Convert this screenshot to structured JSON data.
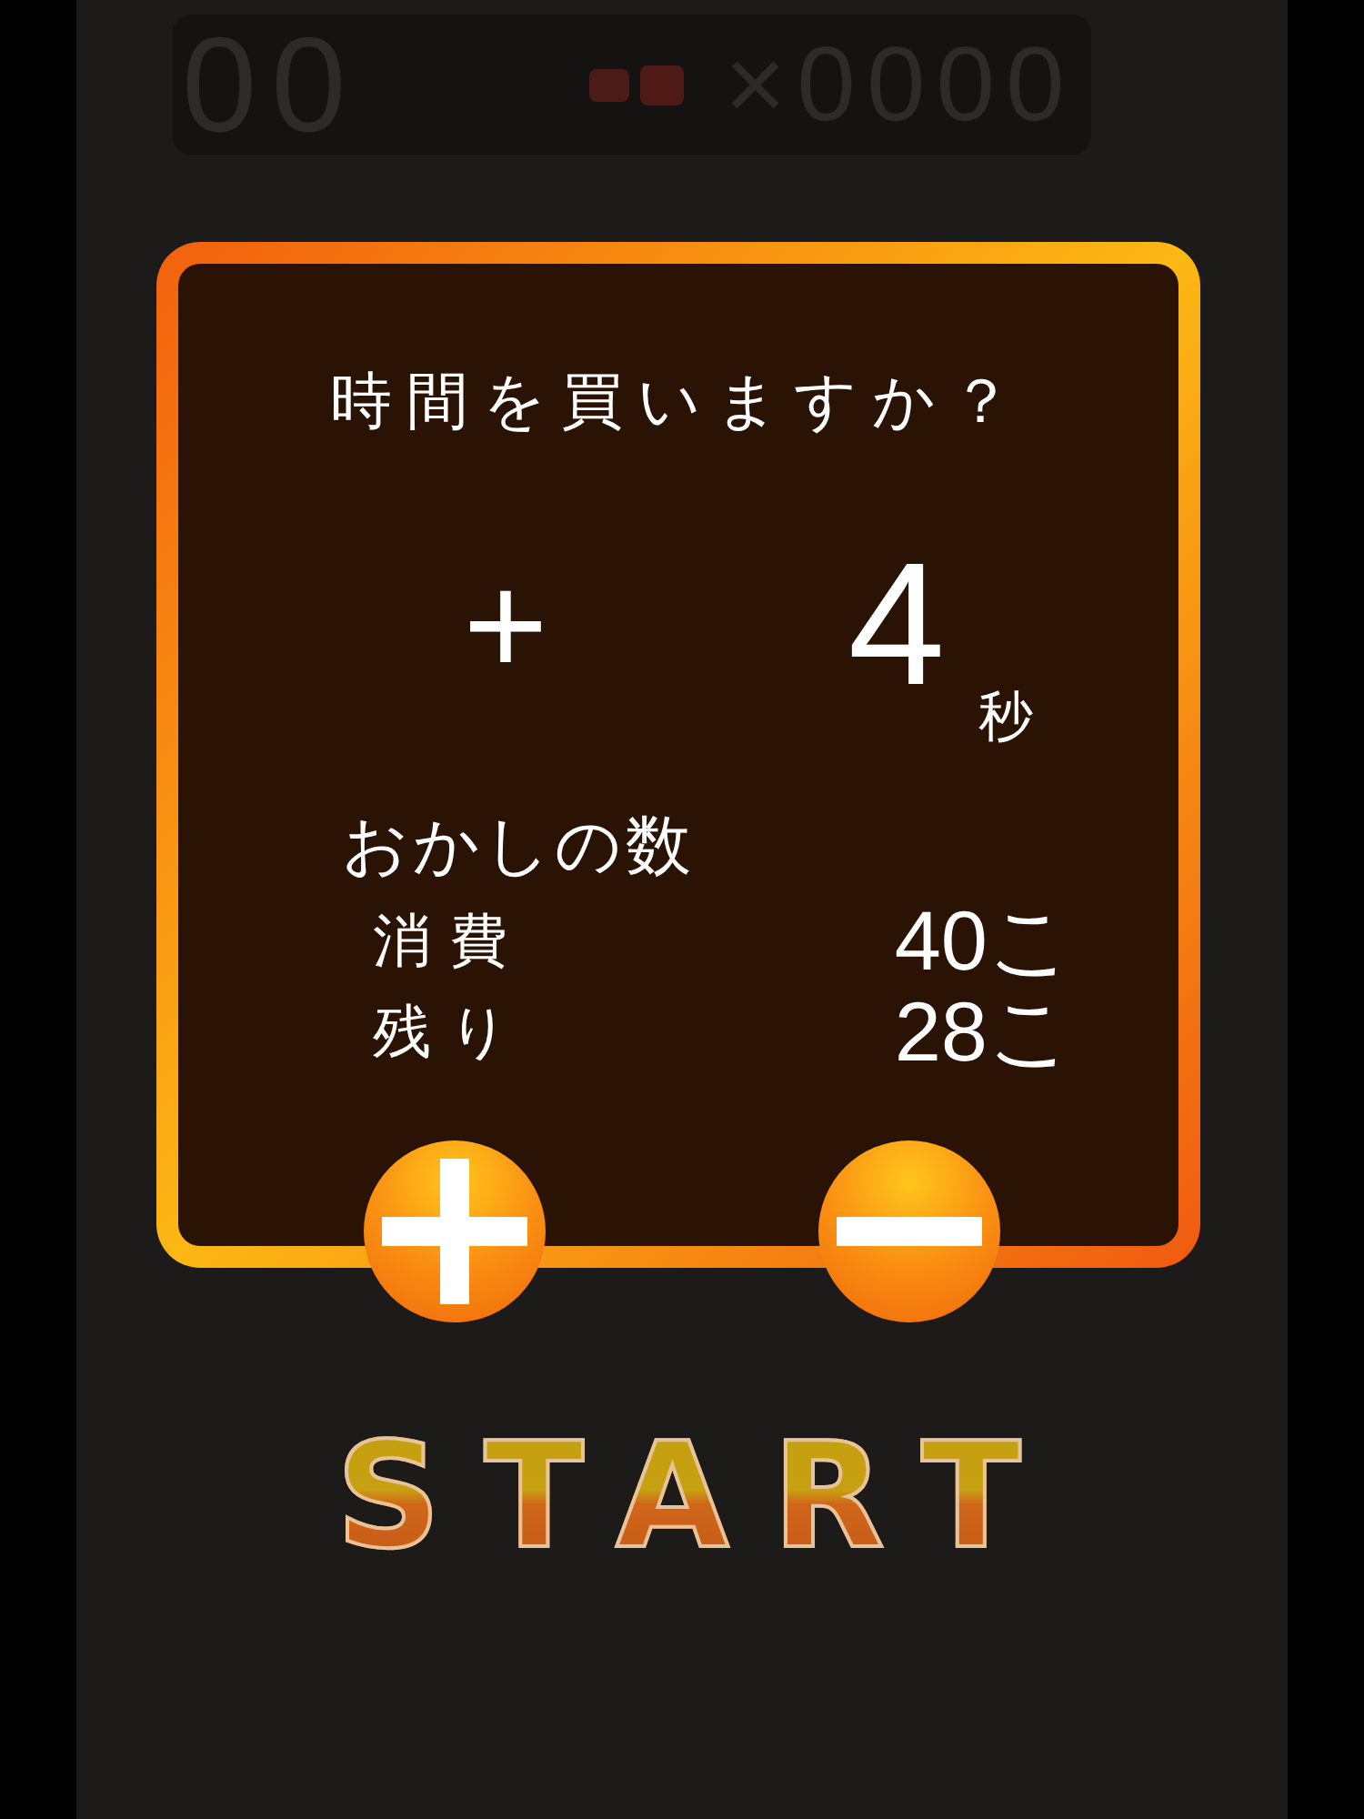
{
  "hud": {
    "timer": "00",
    "multiplier": "×0000"
  },
  "dialog": {
    "title": "時間を買いますか？",
    "sign": "+",
    "amount": "4",
    "unit": "秒",
    "section_label": "おかしの数",
    "rows": [
      {
        "label": "消費",
        "value": "40こ"
      },
      {
        "label": "残り",
        "value": "28こ"
      }
    ],
    "buttons": [
      {
        "kind": "increase"
      },
      {
        "kind": "decrease"
      }
    ]
  },
  "start_button": {
    "label": "START"
  }
}
